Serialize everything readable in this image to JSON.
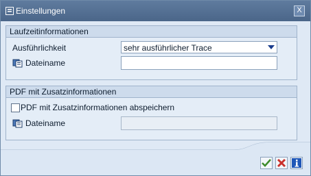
{
  "window": {
    "title": "Einstellungen",
    "close_label": "X"
  },
  "runtime_group": {
    "title": "Laufzeitinformationen",
    "detail_label": "Ausführlichkeit",
    "detail_value": "sehr ausführlicher Trace",
    "filename_label": "Dateiname",
    "filename_value": ""
  },
  "pdf_group": {
    "title": "PDF mit Zusatzinformationen",
    "checkbox_label": "PDF mit Zusatzinformationen abspeichern",
    "checkbox_checked": false,
    "filename_label": "Dateiname",
    "filename_value": ""
  },
  "footer": {
    "buttons": [
      "confirm-icon",
      "cancel-icon",
      "info-icon"
    ]
  }
}
